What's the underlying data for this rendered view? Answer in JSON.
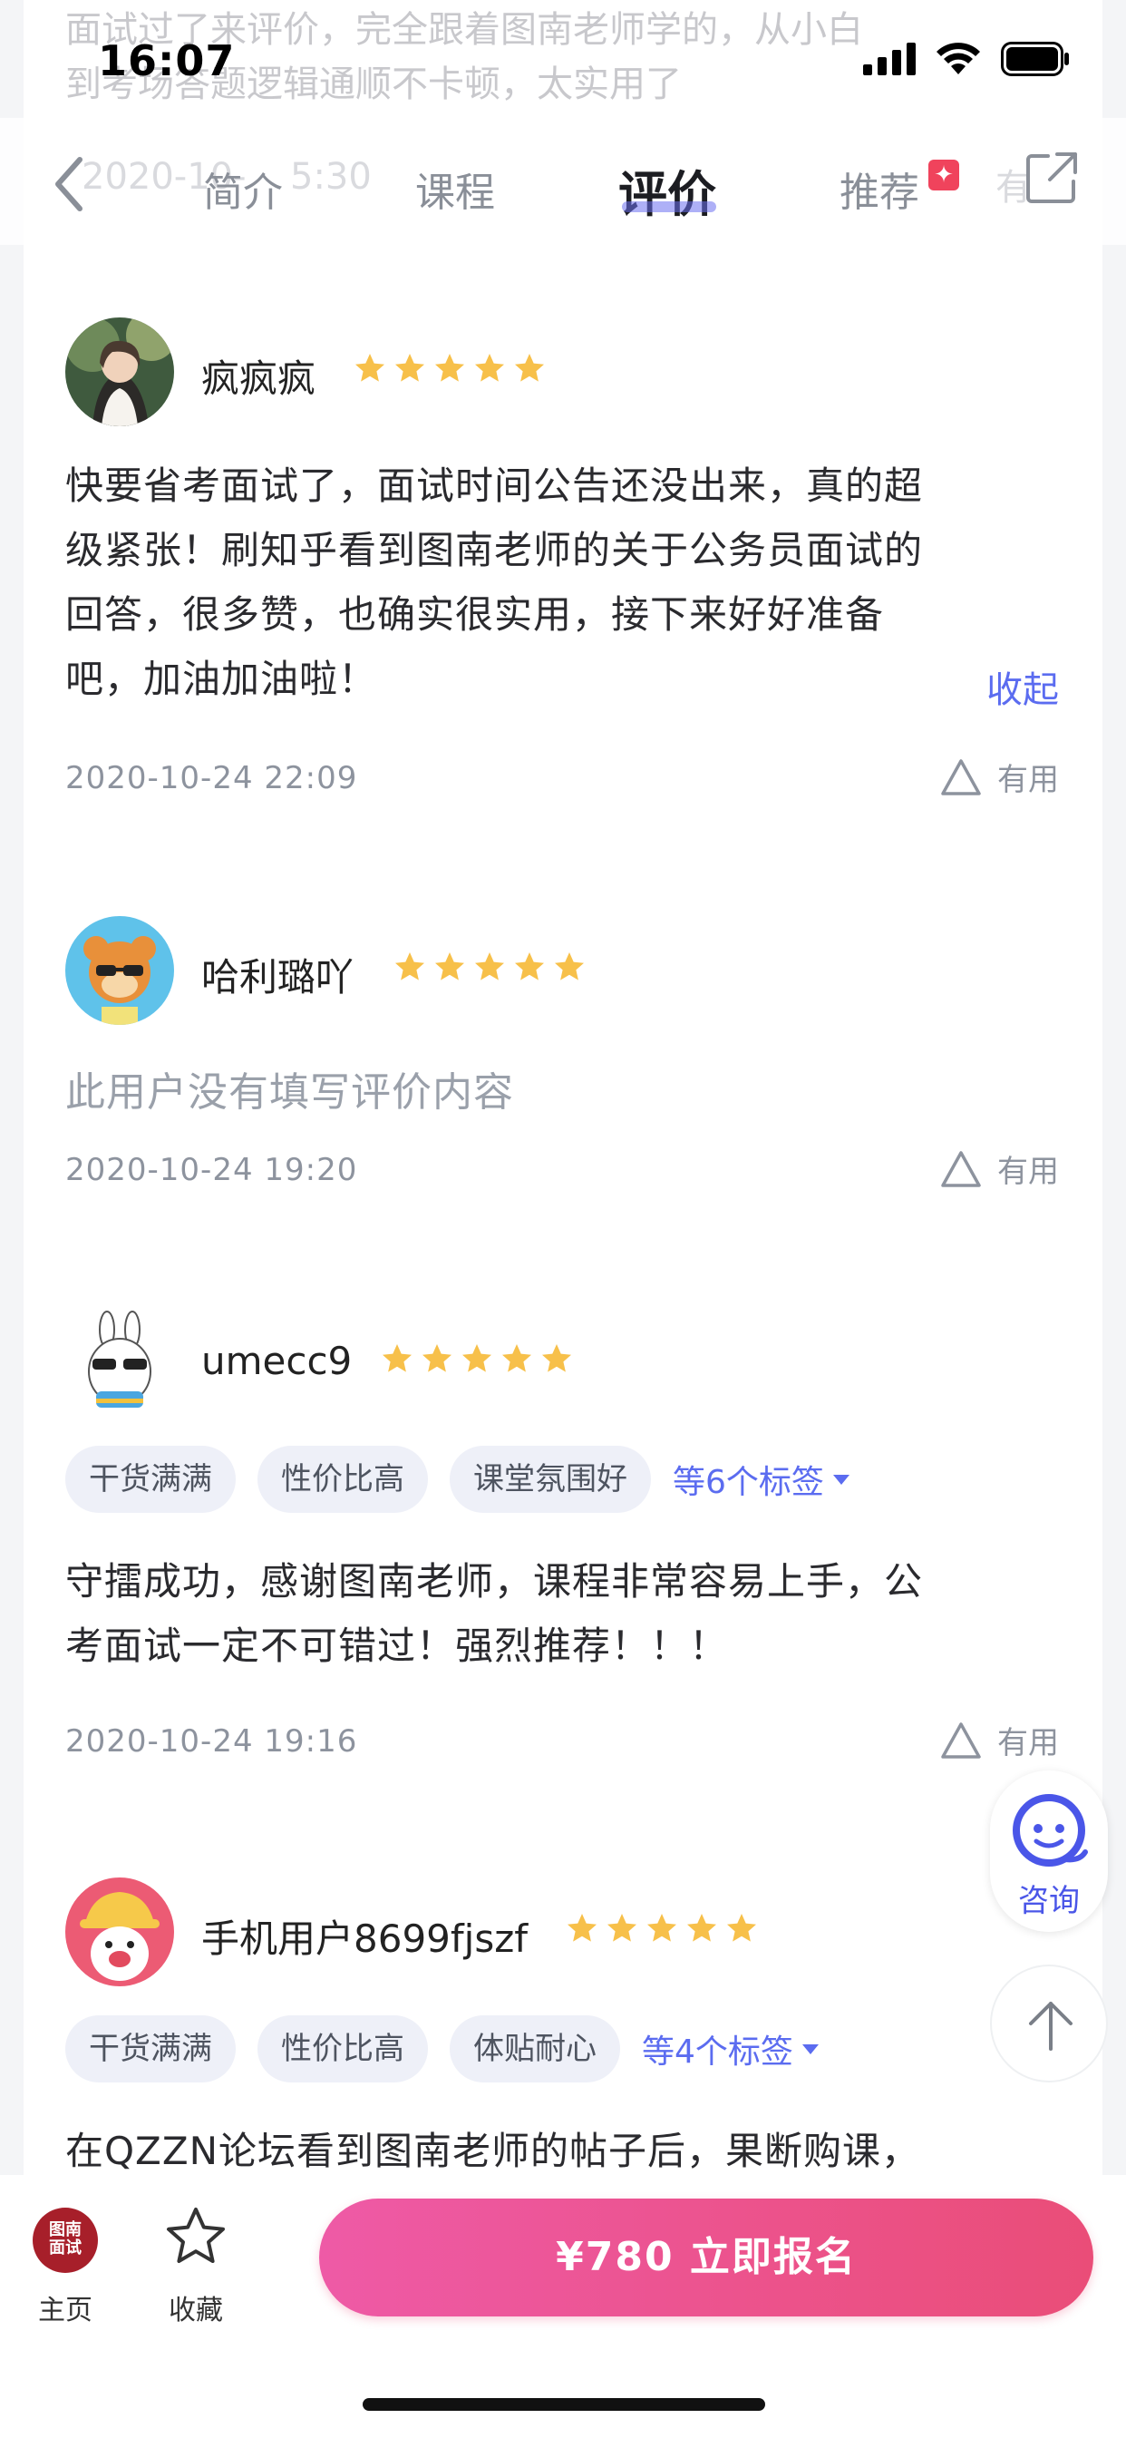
{
  "ghost": {
    "line1": "面试过了来评价，完全跟着图南老师学的，从小白",
    "line2": "到考场答题逻辑通顺不卡顿，太实用了",
    "date": "2020-10-",
    "date_tail": "5:30",
    "useful": "有"
  },
  "status": {
    "time": "16:07"
  },
  "nav": {
    "tabs": [
      {
        "label": "简介"
      },
      {
        "label": "课程"
      },
      {
        "label": "评价",
        "active": true
      },
      {
        "label": "推荐"
      }
    ],
    "badge": "✦"
  },
  "reviews": [
    {
      "user": "疯疯疯",
      "rating": 5,
      "lines": [
        "快要省考面试了，面试时间公告还没出来，真的超",
        "级紧张！刷知乎看到图南老师的关于公务员面试的",
        "回答，很多赞，也确实很实用，接下来好好准备",
        "吧，加油加油啦！"
      ],
      "collapse": "收起",
      "date": "2020-10-24 22:09",
      "useful": "有用"
    },
    {
      "user": "哈利璐吖",
      "rating": 5,
      "empty": "此用户没有填写评价内容",
      "date": "2020-10-24 19:20",
      "useful": "有用"
    },
    {
      "user": "umecc9",
      "rating": 5,
      "tags": [
        "干货满满",
        "性价比高",
        "课堂氛围好"
      ],
      "more_tags": "等6个标签",
      "lines": [
        "守擂成功，感谢图南老师，课程非常容易上手，公",
        "考面试一定不可错过！强烈推荐！！！"
      ],
      "date": "2020-10-24 19:16",
      "useful": "有用"
    },
    {
      "user": "手机用户8699fjszf",
      "rating": 5,
      "tags": [
        "干货满满",
        "性价比高",
        "体贴耐心"
      ],
      "more_tags": "等4个标签",
      "lines": [
        "在QZZN论坛看到图南老师的帖子后，果断购课，"
      ]
    }
  ],
  "float": {
    "consult": "咨询"
  },
  "bottom": {
    "logo_line1": "图南",
    "logo_line2": "面试",
    "home": "主页",
    "favorite": "收藏",
    "cta": "¥780  立即报名"
  },
  "colors": {
    "accent": "#5b6cf0",
    "star": "#f7c04a",
    "cta_start": "#ee5aa6",
    "cta_end": "#ea4d78"
  }
}
